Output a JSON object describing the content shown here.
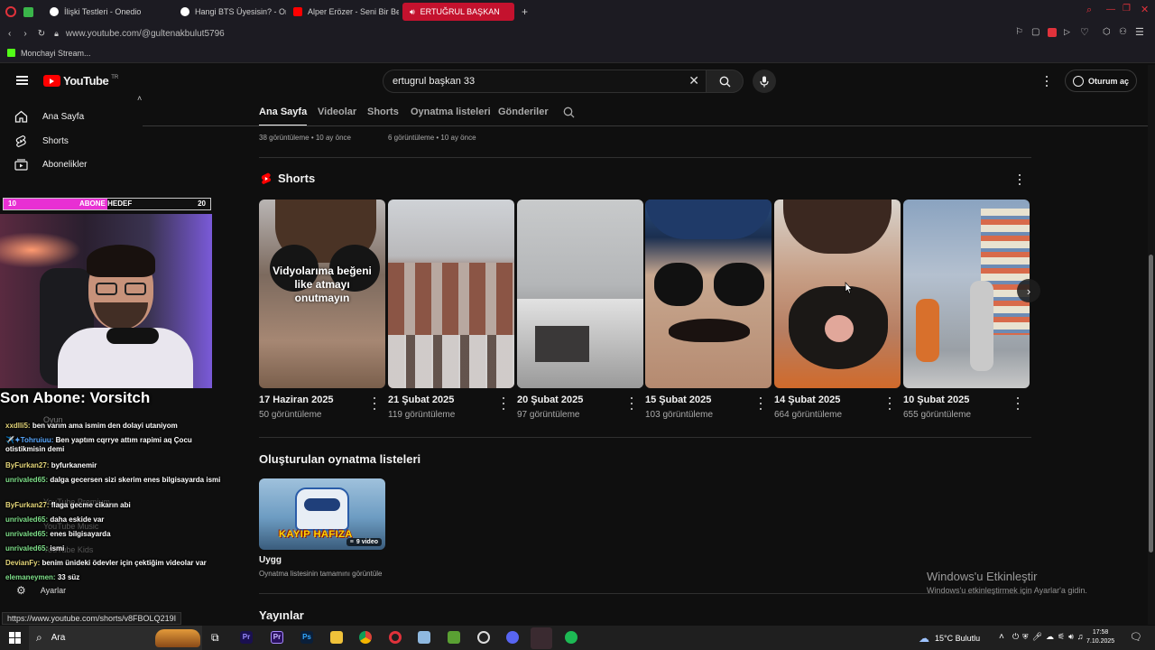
{
  "browser": {
    "tabs": [
      {
        "label": "İlişki Testleri - Onedio"
      },
      {
        "label": "Hangi BTS Üyesisin? - On"
      },
      {
        "label": "Alper Erözer - Seni Bir Be"
      },
      {
        "label": "ERTUĞRUL BAŞKAN"
      }
    ],
    "url": "www.youtube.com/@gultenakbulut5796",
    "bookmark": "Monchayi Stream...",
    "status_url": "https://www.youtube.com/shorts/v8FBOLQ219I"
  },
  "youtube": {
    "logo_text": "YouTube",
    "logo_region": "TR",
    "search_value": "ertugrul başkan 33",
    "signin_label": "Oturum aç"
  },
  "sidebar": {
    "items": [
      {
        "label": "Ana Sayfa"
      },
      {
        "label": "Shorts"
      },
      {
        "label": "Abonelikler"
      }
    ],
    "hidden_items": [
      {
        "label": "Oyun"
      },
      {
        "label": "YouTube Premium"
      },
      {
        "label": "YouTube Music"
      },
      {
        "label": "YouTube Kids"
      },
      {
        "label": "Ayarlar"
      }
    ]
  },
  "channel_tabs": [
    "Ana Sayfa",
    "Videolar",
    "Shorts",
    "Oynatma listeleri",
    "Gönderiler"
  ],
  "prev_row": {
    "left_meta": "38 görüntüleme • 10 ay önce",
    "right_meta": "6 görüntüleme • 10 ay önce"
  },
  "shorts": {
    "title": "Shorts",
    "overlay_text": "Vidyolarıma beğeni like atmayı onutmayın",
    "items": [
      {
        "date": "17 Haziran 2025",
        "views": "50 görüntüleme"
      },
      {
        "date": "21 Şubat 2025",
        "views": "119 görüntüleme"
      },
      {
        "date": "20 Şubat 2025",
        "views": "97 görüntüleme"
      },
      {
        "date": "15 Şubat 2025",
        "views": "103 görüntüleme"
      },
      {
        "date": "14 Şubat 2025",
        "views": "664 görüntüleme"
      },
      {
        "date": "10 Şubat 2025",
        "views": "655 görüntüleme"
      }
    ]
  },
  "playlists": {
    "title": "Oluşturulan oynatma listeleri",
    "item_name": "Uygg",
    "item_sub": "Oynatma listesinin tamamını görüntüle",
    "item_count": "9 video",
    "thumb_text": "KAYIP HAFIZA"
  },
  "broadcasts_title": "Yayınlar",
  "stream_overlay": {
    "goal_left": "10",
    "goal_label": "ABONE HEDEF",
    "goal_right": "20",
    "last_sub": "Son Abone: Vorsitch",
    "chat": [
      {
        "user": "xxdlli5:",
        "text": "ben varım ama ismim den dolayi utaniyom"
      },
      {
        "user": "✈️✦Tohruiuu:",
        "text": "Ben yaptım cqrrye attım rapimi aq Çocu otistikmisin demi"
      },
      {
        "user": "ByFurkan27:",
        "text": "byfurkanemir"
      },
      {
        "user": "unrivaled65:",
        "text": "dalga gecersen sizi skerim enes bilgisayarda ismi"
      },
      {
        "user": "ByFurkan27:",
        "text": "flaga gecme cikarın abi"
      },
      {
        "user": "unrivaled65:",
        "text": "daha eskide var"
      },
      {
        "user": "unrivaled65:",
        "text": "enes bilgisayarda"
      },
      {
        "user": "unrivaled65:",
        "text": "ismi"
      },
      {
        "user": "DevianFy:",
        "text": "benim ünideki ödevler için çektiğim videolar var"
      },
      {
        "user": "elemaneymen:",
        "text": "33 süz"
      }
    ]
  },
  "watermark": {
    "line1": "Windows'u Etkinleştir",
    "line2": "Windows'u etkinleştirmek için Ayarlar'a gidin."
  },
  "taskbar": {
    "search": "Ara",
    "weather": "15°C  Bulutlu",
    "time": "17:58",
    "date": "7.10.2025"
  }
}
